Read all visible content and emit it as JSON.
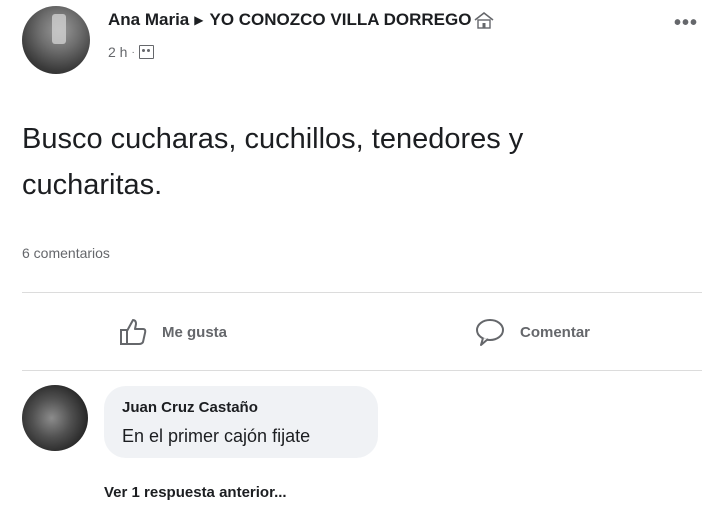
{
  "post": {
    "author": "Ana Maria",
    "separator": "▶",
    "group": "YO CONOZCO VILLA DORREGO",
    "time": "2 h",
    "dot": "·",
    "more": "•••",
    "text": "Busco cucharas, cuchillos, tenedores y cucharitas.",
    "comments_count": "6 comentarios",
    "icons": [
      "house-icon",
      "group-icon",
      "more-icon",
      "like-icon",
      "comment-icon"
    ]
  },
  "actions": {
    "like_label": "Me gusta",
    "comment_label": "Comentar"
  },
  "comment": {
    "author": "Juan Cruz Castaño",
    "text": "En el primer cajón fijate"
  },
  "replies": {
    "label": "Ver 1 respuesta anterior..."
  }
}
